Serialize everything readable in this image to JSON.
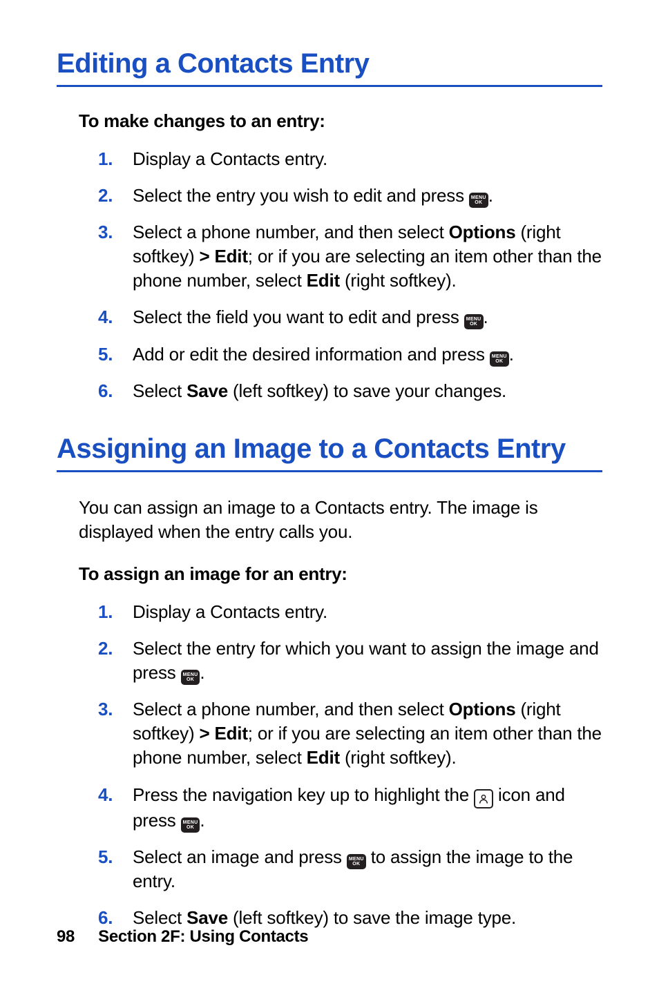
{
  "section1": {
    "heading": "Editing a Contacts Entry",
    "instr_title": "To make changes to an entry:",
    "steps": {
      "s1": "Display a Contacts entry.",
      "s2a": "Select the entry you wish to edit and press ",
      "s2b": ".",
      "s3a": "Select a phone number, and then select ",
      "s3_options": "Options",
      "s3b": " (right softkey) ",
      "s3_gt": ">",
      "s3c": " ",
      "s3_edit": "Edit",
      "s3d": "; or if you are selecting an item other than the phone number, select ",
      "s3_edit2": "Edit",
      "s3e": " (right softkey).",
      "s4a": "Select the field you want to edit and press ",
      "s4b": ".",
      "s5a": "Add or edit the desired information and press ",
      "s5b": ".",
      "s6a": "Select ",
      "s6_save": "Save",
      "s6b": " (left softkey) to save your changes."
    }
  },
  "section2": {
    "heading": "Assigning an Image to a Contacts Entry",
    "intro": "You can assign an image to a Contacts entry. The image is displayed when the entry calls you.",
    "instr_title": "To assign an image for an entry:",
    "steps": {
      "s1": "Display a Contacts entry.",
      "s2a": "Select the entry for which you want to assign the image and press ",
      "s2b": ".",
      "s3a": "Select a phone number, and then select ",
      "s3_options": "Options",
      "s3b": " (right softkey) ",
      "s3_gt": ">",
      "s3c": " ",
      "s3_edit": "Edit",
      "s3d": "; or if you are selecting an item other than the phone number, select ",
      "s3_edit2": "Edit",
      "s3e": " (right softkey).",
      "s4a": "Press the navigation key up to highlight the ",
      "s4b": " icon and press ",
      "s4c": ".",
      "s5a": "Select an image and press ",
      "s5b": " to assign the image to the entry.",
      "s6a": "Select ",
      "s6_save": "Save",
      "s6b": " (left softkey) to save the image type."
    }
  },
  "icons": {
    "menu_ok_top": "MENU",
    "menu_ok_bot": "OK"
  },
  "footer": {
    "page_number": "98",
    "section_label": "Section 2F: Using Contacts"
  }
}
